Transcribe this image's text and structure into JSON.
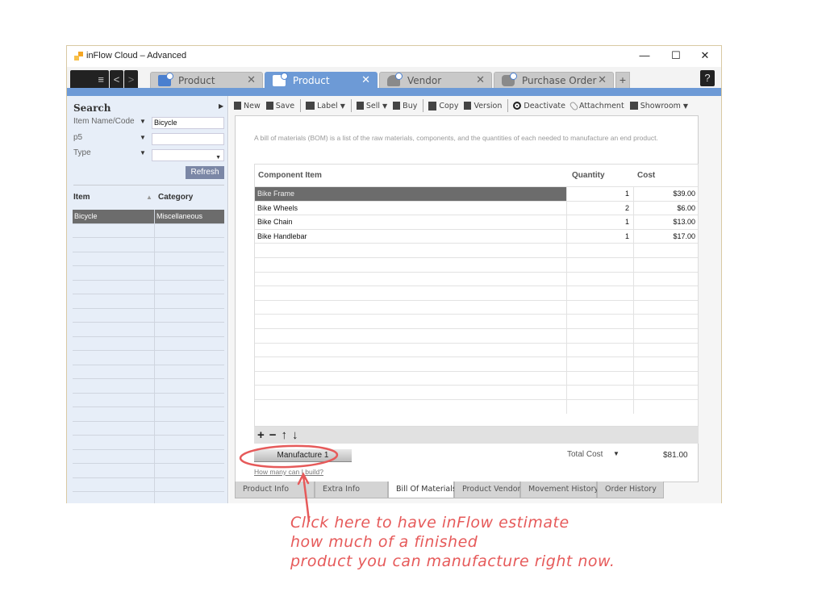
{
  "window": {
    "title": "inFlow Cloud – Advanced",
    "controls": {
      "minimize": "—",
      "maximize": "☐",
      "close": "✕"
    }
  },
  "tabbar": {
    "menu_glyph": "≡",
    "back_glyph": "<",
    "forward_glyph": ">",
    "tabs": [
      {
        "label": "Product",
        "icon": "product-icon",
        "active": false
      },
      {
        "label": "Product",
        "icon": "product-icon",
        "active": true
      },
      {
        "label": "Vendor",
        "icon": "vendor-icon",
        "active": false
      },
      {
        "label": "Purchase Order",
        "icon": "purchase-order-icon",
        "active": false
      }
    ],
    "close_glyph": "✕",
    "add_glyph": "+",
    "help_glyph": "?"
  },
  "sidebar": {
    "title": "Search",
    "fields": [
      {
        "label": "Item Name/Code",
        "value": "Bicycle"
      },
      {
        "label": "p5",
        "value": ""
      },
      {
        "label": "Type",
        "value": ""
      }
    ],
    "refresh_label": "Refresh",
    "list_headers": {
      "item": "Item",
      "category": "Category",
      "sort_glyph": "▲"
    },
    "rows": [
      {
        "item": "Bicycle",
        "category": "Miscellaneous",
        "selected": true
      }
    ]
  },
  "toolbar": {
    "items": [
      {
        "label": "New",
        "icon": "new-document-icon"
      },
      {
        "label": "Save",
        "icon": "save-icon"
      },
      {
        "label": "Label",
        "icon": "label-printer-icon",
        "dropdown": true
      },
      {
        "label": "Sell",
        "icon": "sell-icon",
        "dropdown": true
      },
      {
        "label": "Buy",
        "icon": "buy-icon"
      },
      {
        "label": "Copy",
        "icon": "copy-icon"
      },
      {
        "label": "Version",
        "icon": "version-icon"
      },
      {
        "label": "Deactivate",
        "icon": "deactivate-icon"
      },
      {
        "label": "Attachment",
        "icon": "paperclip-icon"
      },
      {
        "label": "Showroom",
        "icon": "showroom-icon",
        "dropdown": true
      }
    ]
  },
  "bom": {
    "description": "A bill of materials (BOM) is a list of the raw materials, components, and the quantities of each needed to manufacture an end product.",
    "columns": {
      "item": "Component Item",
      "quantity": "Quantity",
      "cost": "Cost"
    },
    "rows": [
      {
        "item": "Bike Frame",
        "quantity": "1",
        "cost": "$39.00",
        "selected": true
      },
      {
        "item": "Bike Wheels",
        "quantity": "2",
        "cost": "$6.00"
      },
      {
        "item": "Bike Chain",
        "quantity": "1",
        "cost": "$13.00"
      },
      {
        "item": "Bike Handlebar",
        "quantity": "1",
        "cost": "$17.00"
      }
    ],
    "row_controls": {
      "add": "+",
      "remove": "−",
      "up": "↑",
      "down": "↓"
    },
    "manufacture_label": "Manufacture 1",
    "total_label": "Total Cost",
    "total_value": "$81.00",
    "build_link": "How many can I build?"
  },
  "bottom_tabs": [
    {
      "label": "Product Info",
      "active": false
    },
    {
      "label": "Extra Info",
      "active": false
    },
    {
      "label": "Bill Of Materials",
      "active": true
    },
    {
      "label": "Product Vendors",
      "active": false
    },
    {
      "label": "Movement History",
      "active": false
    },
    {
      "label": "Order History",
      "active": false
    }
  ],
  "annotation": {
    "lines": [
      "Click here to have inFlow estimate",
      "how much of a finished",
      "product you can manufacture right now."
    ],
    "color": "#e65a5a"
  }
}
